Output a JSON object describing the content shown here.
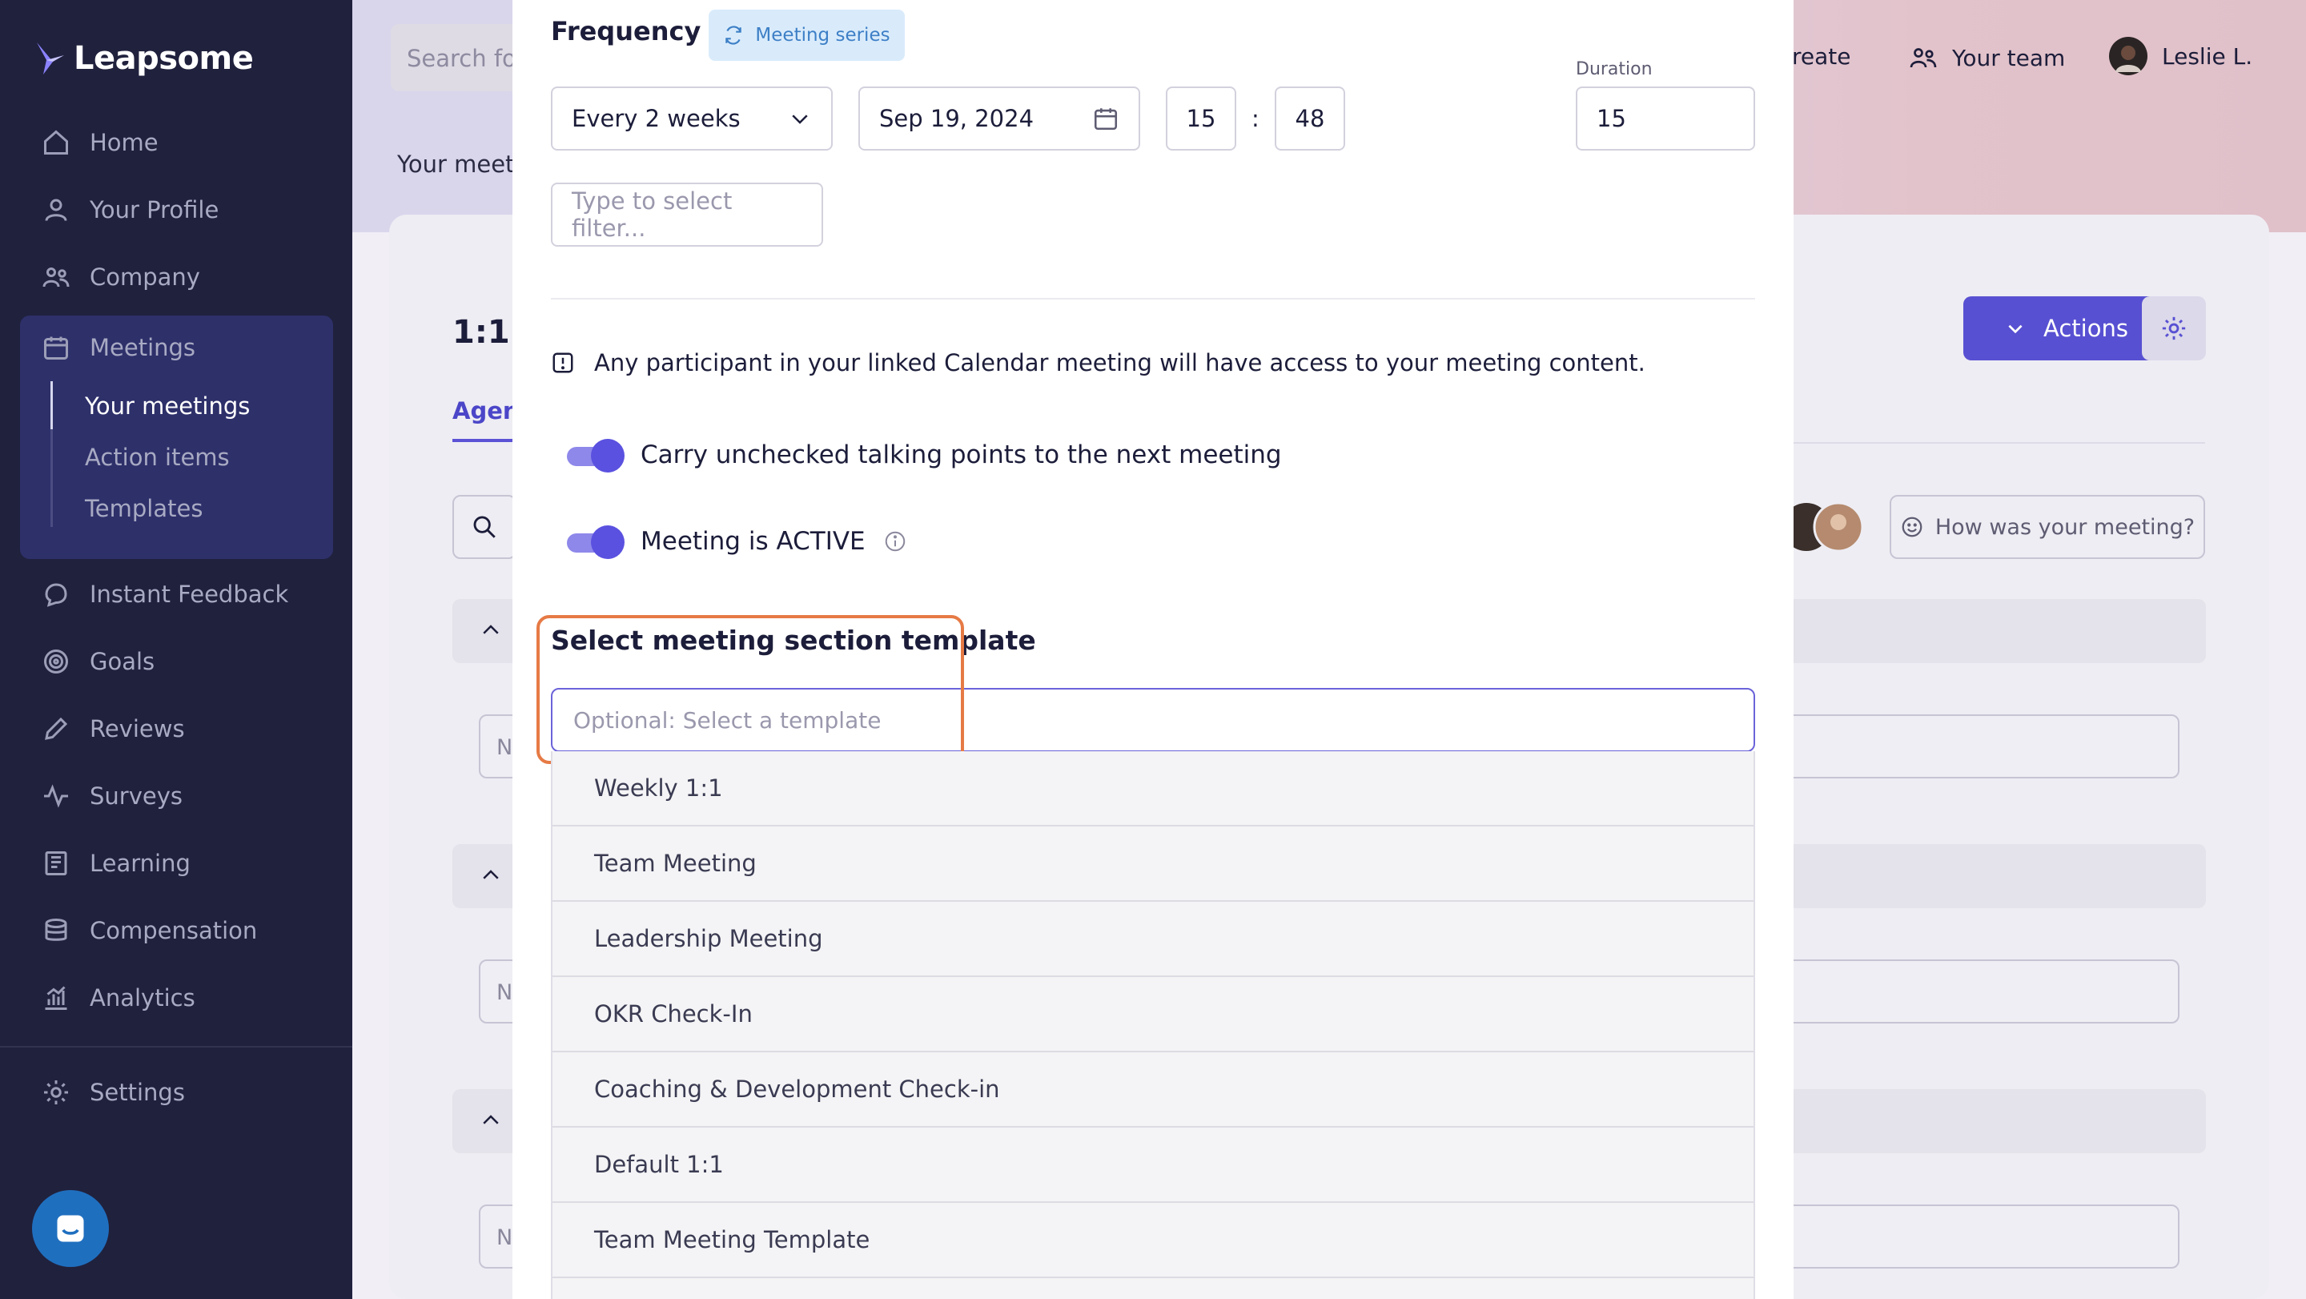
{
  "sidebar": {
    "logo": "Leapsome",
    "items": [
      {
        "label": "Home",
        "icon": "home-icon"
      },
      {
        "label": "Your Profile",
        "icon": "user-icon"
      },
      {
        "label": "Company",
        "icon": "users-icon"
      },
      {
        "label": "Meetings",
        "icon": "calendar-icon"
      },
      {
        "label": "Instant Feedback",
        "icon": "chat-icon"
      },
      {
        "label": "Goals",
        "icon": "target-icon"
      },
      {
        "label": "Reviews",
        "icon": "pencil-icon"
      },
      {
        "label": "Surveys",
        "icon": "pulse-icon"
      },
      {
        "label": "Learning",
        "icon": "book-icon"
      },
      {
        "label": "Compensation",
        "icon": "coins-icon"
      },
      {
        "label": "Analytics",
        "icon": "chart-icon"
      },
      {
        "label": "Settings",
        "icon": "gear-icon"
      }
    ],
    "meetings_sub": [
      {
        "label": "Your meetings",
        "active": true
      },
      {
        "label": "Action items",
        "active": false
      },
      {
        "label": "Templates",
        "active": false
      }
    ]
  },
  "topbar": {
    "search_placeholder": "Search fo",
    "create_label": "reate",
    "team_label": "Your team",
    "user_name": "Leslie L."
  },
  "background": {
    "breadcrumb": "Your meeti",
    "page_title": "1:1 v",
    "tab_agenda": "Agen",
    "actions_label": "Actions",
    "rate_meeting": "How was your meeting?",
    "field_placeholder": "N"
  },
  "modal": {
    "frequency_label": "Frequency",
    "series_badge": "Meeting series",
    "frequency_value": "Every 2 weeks",
    "date_value": "Sep 19, 2024",
    "hour_value": "15",
    "time_separator": ":",
    "minute_value": "48",
    "duration_label": "Duration",
    "duration_value": "15",
    "filter_placeholder": "Type to select filter...",
    "notice": "Any participant in your linked Calendar meeting will have access to your meeting content.",
    "toggle_carry": "Carry unchecked talking points to the next meeting",
    "toggle_active": "Meeting is ACTIVE",
    "template_section_title": "Select meeting section template",
    "template_placeholder": "Optional: Select a template",
    "template_options": [
      "Weekly 1:1",
      "Team Meeting",
      "Leadership Meeting",
      "OKR Check-In",
      "Coaching & Development Check-in",
      "Default 1:1",
      "Team Meeting Template"
    ]
  },
  "colors": {
    "sidebar_bg": "#20213d",
    "accent": "#5850d2",
    "highlight": "#e67a45"
  }
}
